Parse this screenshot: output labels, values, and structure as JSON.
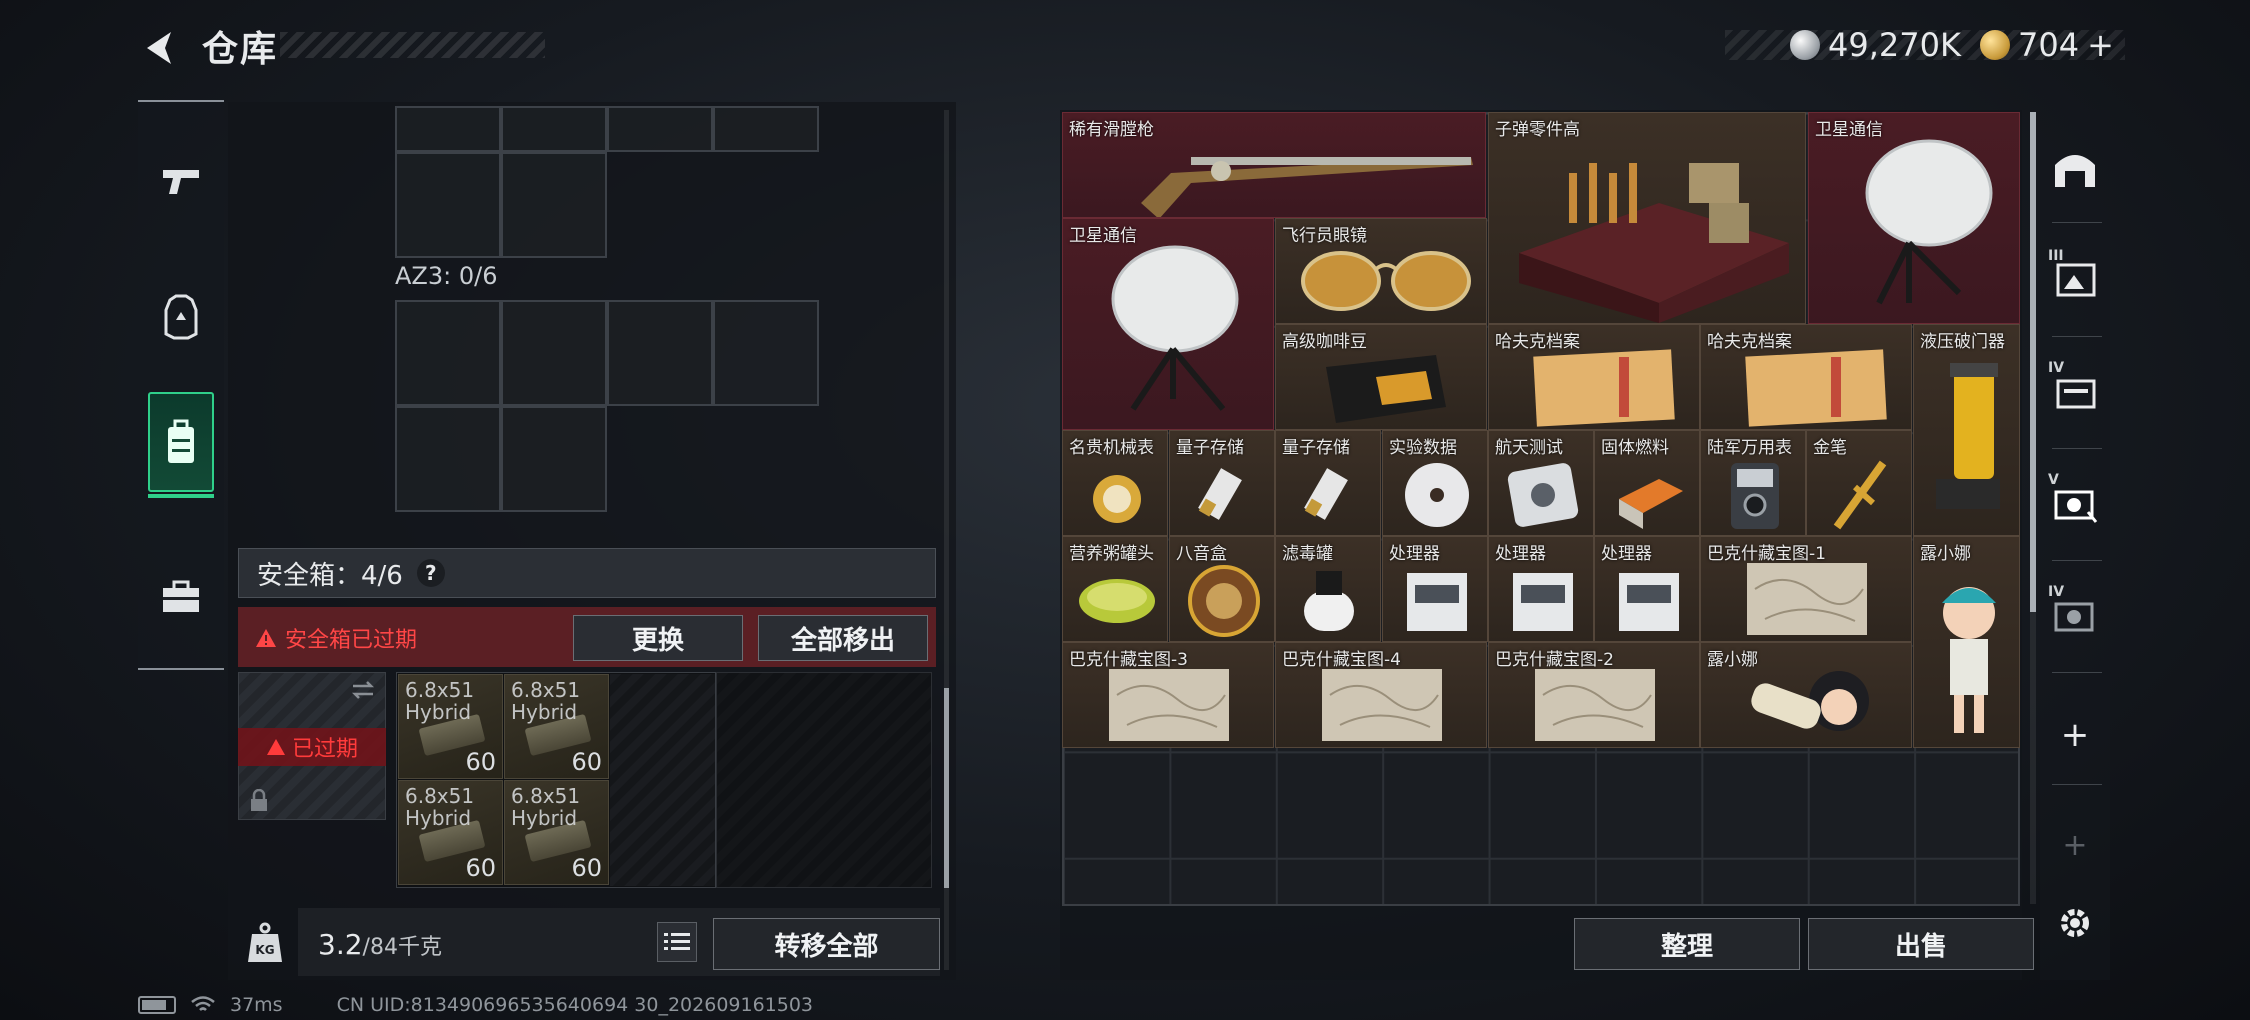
{
  "header": {
    "title": "仓库"
  },
  "currency": {
    "silver": "49,270K",
    "gold": "704",
    "add_symbol": "+"
  },
  "left_nav": {
    "items": [
      "weapons",
      "armor",
      "backpack",
      "case"
    ]
  },
  "containers": {
    "az3_label": "AZ3: 0/6"
  },
  "safe_box": {
    "title": "安全箱：4/6",
    "help": "?",
    "alert": "安全箱已过期",
    "replace_label": "更换",
    "remove_all_label": "全部移出",
    "expired_tag": "已过期",
    "ammo": [
      {
        "name": "6.8x51\nHybrid",
        "qty": "60"
      },
      {
        "name": "6.8x51\nHybrid",
        "qty": "60"
      },
      {
        "name": "6.8x51\nHybrid",
        "qty": "60"
      },
      {
        "name": "6.8x51\nHybrid",
        "qty": "60"
      }
    ]
  },
  "weight": {
    "current": "3.2",
    "max": "/84千克"
  },
  "left_footer": {
    "transfer_all_label": "转移全部"
  },
  "warehouse": {
    "items": [
      "稀有滑膛枪",
      "子弹零件高",
      "卫星通信",
      "卫星通信",
      "飞行员眼镜",
      "高级咖啡豆",
      "哈夫克档案",
      "哈夫克档案",
      "液压破门器",
      "名贵机械表",
      "量子存储",
      "量子存储",
      "实验数据",
      "航天测试",
      "固体燃料",
      "陆军万用表",
      "金笔",
      "营养粥罐头",
      "八音盒",
      "滤毒罐",
      "处理器",
      "处理器",
      "处理器",
      "巴克什藏宝图-1",
      "露小娜",
      "巴克什藏宝图-3",
      "巴克什藏宝图-4",
      "巴克什藏宝图-2",
      "露小娜"
    ],
    "organize_label": "整理",
    "sell_label": "出售"
  },
  "right_nav": {
    "roman": [
      "III",
      "IV",
      "V",
      "IV"
    ],
    "add": "+"
  },
  "status": {
    "ping": "37ms",
    "uid": "CN UID:813490696535640694 30_202609161503"
  }
}
